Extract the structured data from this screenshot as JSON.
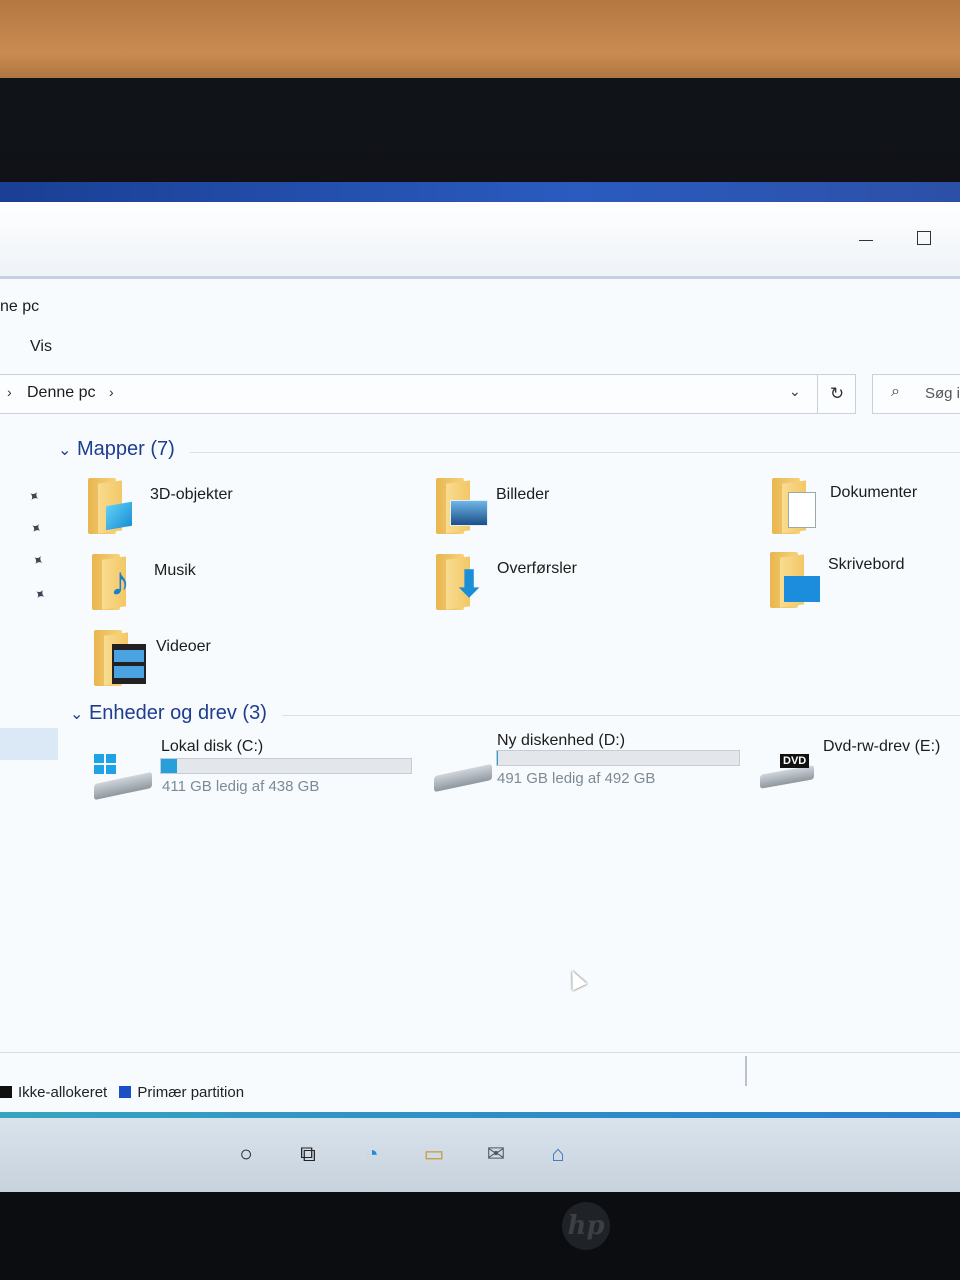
{
  "window": {
    "title": "ne pc",
    "ribbon_tab": "Vis",
    "minimize_icon": "minimize-icon",
    "maximize_icon": "maximize-icon"
  },
  "address": {
    "breadcrumb": "Denne pc",
    "search_placeholder": "Søg i"
  },
  "sections": {
    "folders_title": "Mapper (7)",
    "drives_title": "Enheder og drev (3)"
  },
  "folders": [
    {
      "label": "3D-objekter",
      "icon": "3d-objects-icon"
    },
    {
      "label": "Billeder",
      "icon": "pictures-icon"
    },
    {
      "label": "Dokumenter",
      "icon": "documents-icon"
    },
    {
      "label": "Musik",
      "icon": "music-icon"
    },
    {
      "label": "Overførsler",
      "icon": "downloads-icon"
    },
    {
      "label": "Skrivebord",
      "icon": "desktop-icon"
    },
    {
      "label": "Videoer",
      "icon": "videos-icon"
    }
  ],
  "drives": [
    {
      "label": "Lokal disk (C:)",
      "free": "411 GB ledig af 438 GB",
      "used_fraction": 0.062
    },
    {
      "label": "Ny diskenhed (D:)",
      "free": "491 GB ledig af 492 GB",
      "used_fraction": 0.002
    },
    {
      "label": "Dvd-rw-drev (E:)",
      "badge": "DVD"
    }
  ],
  "legend": {
    "unallocated": "Ikke-allokeret",
    "primary": "Primær partition",
    "unallocated_color": "#111111",
    "primary_color": "#1c4fc4"
  },
  "brand": "hp",
  "colors": {
    "accent": "#26a0da",
    "section_heading": "#1e3d91"
  }
}
